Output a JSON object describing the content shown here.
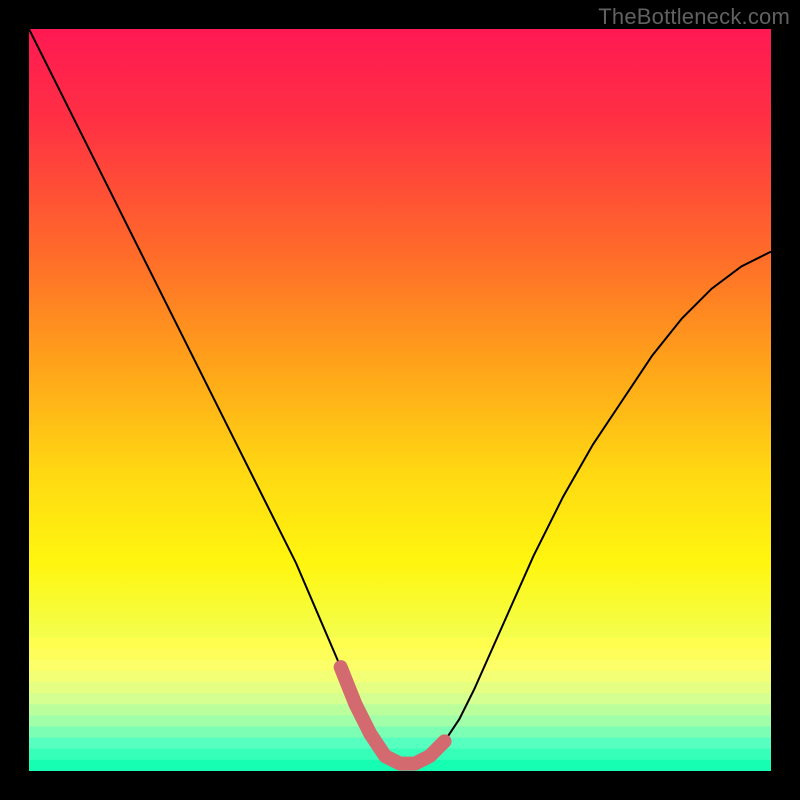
{
  "watermark": "TheBottleneck.com",
  "colors": {
    "background": "#000000",
    "watermark": "#616161",
    "curve_stroke": "#000000",
    "bottom_highlight": "#d26a6f",
    "gradient_stops": [
      {
        "offset": 0,
        "color": "#ff1953"
      },
      {
        "offset": 12,
        "color": "#ff2f44"
      },
      {
        "offset": 30,
        "color": "#ff6a2a"
      },
      {
        "offset": 45,
        "color": "#ffa21a"
      },
      {
        "offset": 60,
        "color": "#ffd912"
      },
      {
        "offset": 72,
        "color": "#fff60f"
      },
      {
        "offset": 82,
        "color": "#f3ff4e"
      },
      {
        "offset": 88,
        "color": "#c6ff86"
      },
      {
        "offset": 93,
        "color": "#7effb0"
      },
      {
        "offset": 97,
        "color": "#33ffbf"
      },
      {
        "offset": 100,
        "color": "#17fdb1"
      }
    ],
    "band_stops": [
      {
        "offset": 0,
        "color": "#fffd4e"
      },
      {
        "offset": 22,
        "color": "#fbff6c"
      },
      {
        "offset": 45,
        "color": "#d6ff8f"
      },
      {
        "offset": 65,
        "color": "#9dffab"
      },
      {
        "offset": 82,
        "color": "#55ffbf"
      },
      {
        "offset": 100,
        "color": "#15feb2"
      }
    ]
  },
  "chart_data": {
    "type": "line",
    "title": "",
    "xlabel": "",
    "ylabel": "",
    "xlim": [
      0,
      100
    ],
    "ylim": [
      0,
      100
    ],
    "series": [
      {
        "name": "bottleneck-curve",
        "x": [
          0,
          4,
          8,
          12,
          16,
          20,
          24,
          28,
          32,
          36,
          39,
          42,
          44,
          46,
          48,
          50,
          52,
          54,
          56,
          58,
          60,
          64,
          68,
          72,
          76,
          80,
          84,
          88,
          92,
          96,
          100
        ],
        "y": [
          100,
          92,
          84,
          76,
          68,
          60,
          52,
          44,
          36,
          28,
          21,
          14,
          9,
          5,
          2,
          1,
          1,
          2,
          4,
          7,
          11,
          20,
          29,
          37,
          44,
          50,
          56,
          61,
          65,
          68,
          70
        ]
      }
    ],
    "highlight_segment": {
      "name": "bottom-band",
      "x": [
        42,
        44,
        46,
        48,
        50,
        52,
        54,
        56
      ],
      "y": [
        14,
        9,
        5,
        2,
        1,
        1,
        2,
        4
      ]
    }
  }
}
